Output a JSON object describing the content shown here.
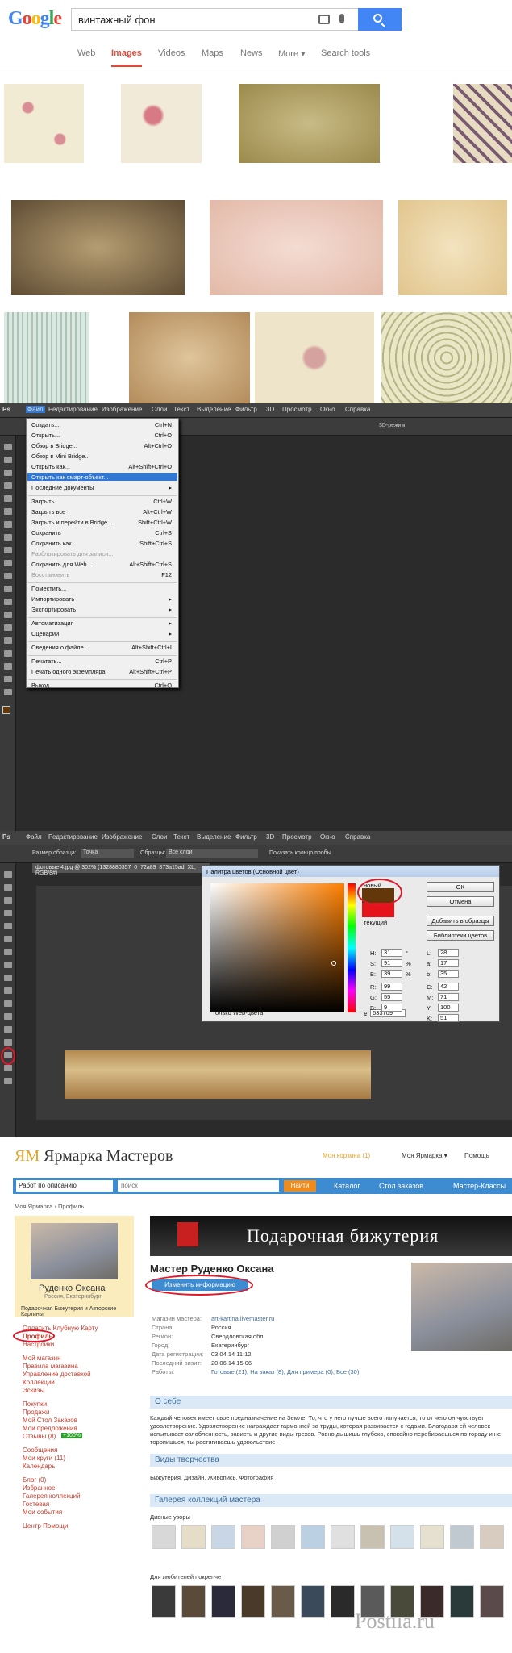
{
  "google": {
    "logo": "Google",
    "query": "винтажный фон",
    "tabs": [
      "Web",
      "Images",
      "Videos",
      "Maps",
      "News",
      "More ▾",
      "Search tools"
    ],
    "colors": {
      "blue": "#4285f4",
      "red": "#dd4b39"
    }
  },
  "ps1": {
    "logo": "Ps",
    "menubar": [
      "Файл",
      "Редактирование",
      "Изображение",
      "Слои",
      "Текст",
      "Выделение",
      "Фильтр",
      "3D",
      "Просмотр",
      "Окно",
      "Справка"
    ],
    "zoom": "3D-режим:",
    "menu_items": [
      {
        "label": "Создать...",
        "shortcut": "Ctrl+N"
      },
      {
        "label": "Открыть...",
        "shortcut": "Ctrl+O"
      },
      {
        "label": "Обзор в Bridge...",
        "shortcut": "Alt+Ctrl+O"
      },
      {
        "label": "Обзор в Mini Bridge...",
        "shortcut": ""
      },
      {
        "label": "Открыть как...",
        "shortcut": "Alt+Shift+Ctrl+O"
      },
      {
        "label": "Открыть как смарт-объект...",
        "shortcut": ""
      },
      {
        "label": "Последние документы",
        "shortcut": "▸"
      },
      {
        "label": "Закрыть",
        "shortcut": "Ctrl+W"
      },
      {
        "label": "Закрыть все",
        "shortcut": "Alt+Ctrl+W"
      },
      {
        "label": "Закрыть и перейти в Bridge...",
        "shortcut": "Shift+Ctrl+W"
      },
      {
        "label": "Сохранить",
        "shortcut": "Ctrl+S"
      },
      {
        "label": "Сохранить как...",
        "shortcut": "Shift+Ctrl+S"
      },
      {
        "label": "Разблокировать для записи...",
        "shortcut": ""
      },
      {
        "label": "Сохранить для Web...",
        "shortcut": "Alt+Shift+Ctrl+S"
      },
      {
        "label": "Восстановить",
        "shortcut": "F12"
      },
      {
        "label": "Поместить...",
        "shortcut": ""
      },
      {
        "label": "Импортировать",
        "shortcut": "▸"
      },
      {
        "label": "Экспортировать",
        "shortcut": "▸"
      },
      {
        "label": "Автоматизация",
        "shortcut": "▸"
      },
      {
        "label": "Сценарии",
        "shortcut": "▸"
      },
      {
        "label": "Сведения о файле...",
        "shortcut": "Alt+Shift+Ctrl+I"
      },
      {
        "label": "Печатать...",
        "shortcut": "Ctrl+P"
      },
      {
        "label": "Печать одного экземпляра",
        "shortcut": "Alt+Shift+Ctrl+P"
      },
      {
        "label": "Выход",
        "shortcut": "Ctrl+Q"
      }
    ]
  },
  "ps2": {
    "options": [
      "Размер образца:",
      "Точка",
      "Образцы:",
      "Все слои",
      "Показать кольцо пробы"
    ],
    "doc_tab": "фотовые 4.jpg @ 302% (1328880357_0_72a89_873a15ad_XL, RGB/8#)",
    "dialog_title": "Палитра цветов (Основной цвет)",
    "new_label": "новый",
    "current_label": "текущий",
    "buttons": [
      "OK",
      "Отмена",
      "Добавить в образцы",
      "Библиотеки цветов"
    ],
    "fields": [
      {
        "k": "H:",
        "v": "31",
        "u": "°"
      },
      {
        "k": "S:",
        "v": "91",
        "u": "%"
      },
      {
        "k": "B:",
        "v": "39",
        "u": "%"
      },
      {
        "k": "R:",
        "v": "99",
        "u": ""
      },
      {
        "k": "G:",
        "v": "55",
        "u": ""
      },
      {
        "k": "B:",
        "v": "9",
        "u": ""
      }
    ],
    "lab_fields": [
      {
        "k": "L:",
        "v": "28"
      },
      {
        "k": "a:",
        "v": "17"
      },
      {
        "k": "b:",
        "v": "35"
      },
      {
        "k": "C:",
        "v": "42"
      },
      {
        "k": "M:",
        "v": "71"
      },
      {
        "k": "Y:",
        "v": "100"
      },
      {
        "k": "K:",
        "v": "51"
      }
    ],
    "hex": "633709",
    "web_only": "Только Web-цвета",
    "new_color": "#633709",
    "current_color": "#e4141a"
  },
  "ym": {
    "logo_mark": "ЯМ",
    "logo": "Ярмарка Мастеров",
    "cart": "Моя корзина (1)",
    "my": "Моя Ярмарка ▾",
    "help": "Помощь",
    "select": "Работ по описанию",
    "search": "поиск",
    "find": "Найти",
    "nav": [
      "Каталог",
      "Стол заказов",
      "Мастер-Классы"
    ],
    "crumb": "Моя Ярмарка › Профиль",
    "name": "Руденко Оксана",
    "location": "Россия, Екатеринбург",
    "tagline": "Подарочная Бижутерия и Авторские Картины",
    "banner": "Подарочная бижутерия",
    "title": "Мастер Руденко Оксана",
    "edit": "Изменить информацию",
    "profile_rows": [
      {
        "k": "Магазин мастера:",
        "v": "art-kartina.livemaster.ru"
      },
      {
        "k": "Страна:",
        "v": "Россия"
      },
      {
        "k": "Регион:",
        "v": "Свердловская обл."
      },
      {
        "k": "Город:",
        "v": "Екатеринбург"
      },
      {
        "k": "Дата регистрации:",
        "v": "03.04.14 11:12"
      },
      {
        "k": "Последний визит:",
        "v": "20.06.14 15:06"
      },
      {
        "k": "Работы:",
        "v": "Готовые (21), На заказ (8), Для примера (0), Все (30)"
      }
    ],
    "about_title": "О себе",
    "about": "Каждый человек имеет свое предназначение на Земле. То, что у него лучше всего получается, то от чего он чувствует удовлетворение. Удовлетворение награждает гармонией за труды, которая развивается с годами. Благодаря ей человек испытывает озлобленность, зависть и другие виды грехов. Ровно дышишь глубоко, спокойно перебираешься по городу и не торопишься, ты растягиваешь удовольствие -",
    "kinds_title": "Виды творчества",
    "kinds": "Бижутерия, Дизайн, Живопись, Фотография",
    "gallery_title": "Галерея коллекций мастера",
    "coll1": "Дивные узоры",
    "coll2": "Для любителей покрепче",
    "side_links": [
      "Оплатить Клубную Карту",
      "Профиль",
      "Настройки",
      "Мой магазин",
      "Правила магазина",
      "Управление доставкой",
      "Коллекции",
      "Эскизы",
      "Покупки",
      "Продажи",
      "Мой Стол Заказов",
      "Мои предложения",
      "Отзывы (8)",
      "Сообщения",
      "Мои круги (11)",
      "Календарь",
      "Блог (0)",
      "Избранное",
      "Галерея коллекций",
      "Гостевая",
      "Мои события",
      "Центр Помощи"
    ],
    "reviews_badge": "+100%",
    "watermark": "Postila.ru"
  }
}
